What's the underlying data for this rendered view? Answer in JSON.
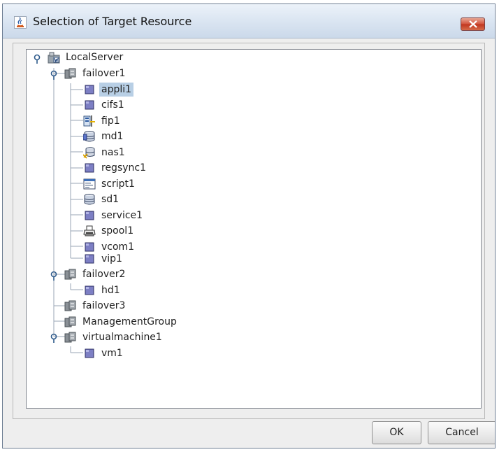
{
  "window": {
    "title": "Selection of Target Resource",
    "icon": "java-icon",
    "close_icon": "close-icon"
  },
  "tree": {
    "root": "LocalServer",
    "items": [
      {
        "label": "LocalServer",
        "icon": "server-icon",
        "selected": false
      },
      {
        "label": "failover1",
        "icon": "group-icon",
        "selected": false
      },
      {
        "label": "appli1",
        "icon": "resource-icon",
        "selected": true
      },
      {
        "label": "cifs1",
        "icon": "resource-icon",
        "selected": false
      },
      {
        "label": "fip1",
        "icon": "fip-icon",
        "selected": false
      },
      {
        "label": "md1",
        "icon": "disk-icon",
        "selected": false
      },
      {
        "label": "nas1",
        "icon": "nas-icon",
        "selected": false
      },
      {
        "label": "regsync1",
        "icon": "resource-icon",
        "selected": false
      },
      {
        "label": "script1",
        "icon": "script-icon",
        "selected": false
      },
      {
        "label": "sd1",
        "icon": "disk-icon",
        "selected": false
      },
      {
        "label": "service1",
        "icon": "resource-icon",
        "selected": false
      },
      {
        "label": "spool1",
        "icon": "printer-icon",
        "selected": false
      },
      {
        "label": "vcom1",
        "icon": "resource-icon",
        "selected": false
      },
      {
        "label": "vip1",
        "icon": "resource-icon",
        "selected": false
      },
      {
        "label": "failover2",
        "icon": "group-icon",
        "selected": false
      },
      {
        "label": "hd1",
        "icon": "resource-icon",
        "selected": false
      },
      {
        "label": "failover3",
        "icon": "group-icon",
        "selected": false
      },
      {
        "label": "ManagementGroup",
        "icon": "group-icon",
        "selected": false
      },
      {
        "label": "virtualmachine1",
        "icon": "group-icon",
        "selected": false
      },
      {
        "label": "vm1",
        "icon": "resource-icon",
        "selected": false
      }
    ]
  },
  "buttons": {
    "ok_label": "OK",
    "cancel_label": "Cancel"
  },
  "colors": {
    "selection": "#b8cfe5",
    "title_gradient": "#d9e4f1",
    "close_button": "#d3553e",
    "resource_square": "#7d7fc4"
  }
}
